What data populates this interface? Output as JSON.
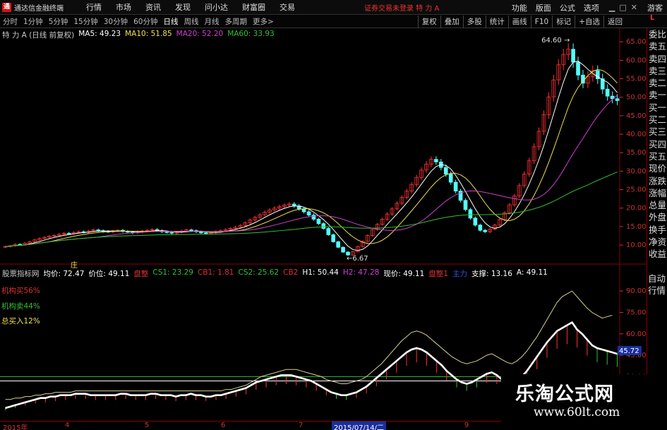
{
  "app": {
    "name": "通达信金融终端",
    "logo_char": "通",
    "login_notice": "证券交易未登录  特 力 A",
    "menu": [
      "行情",
      "市场",
      "资讯",
      "发现",
      "问小达",
      "财富圈",
      "交易"
    ],
    "right_menu": [
      "功能",
      "版面",
      "公式",
      "选项"
    ],
    "guest": "游客"
  },
  "periods": [
    "分时",
    "1分钟",
    "5分钟",
    "15分钟",
    "30分钟",
    "60分钟",
    "日线",
    "周线",
    "月线",
    "多周期",
    "更多>"
  ],
  "active_period": "日线",
  "toolbar": [
    "复权",
    "叠加",
    "多股",
    "统计",
    "画线",
    "F10",
    "标记",
    "+自选",
    "返回"
  ],
  "right_panel": {
    "top": [
      "委比",
      "卖五",
      "卖四",
      "卖三",
      "卖二",
      "卖一",
      "买一",
      "买二",
      "买三",
      "买四",
      "买五",
      "现价",
      "涨跌",
      "涨幅",
      "总量",
      "外盘",
      "换手",
      "净资",
      "收益"
    ],
    "bottom": [
      "自动",
      "行情"
    ],
    "indicator_l": "L"
  },
  "ma_legend": {
    "title": "特 力 A (日线 前复权)",
    "items": [
      {
        "label": "MA5: 49.23",
        "color": "#ffffff"
      },
      {
        "label": "MA10: 51.85",
        "color": "#f0e050"
      },
      {
        "label": "MA20: 52.20",
        "color": "#d040d0"
      },
      {
        "label": "MA60: 33.93",
        "color": "#30c030"
      }
    ]
  },
  "indicator_legend": {
    "title": "股票指标网",
    "items": [
      {
        "label": "均价: 72.47",
        "color": "#ffffff"
      },
      {
        "label": "价位: 49.11",
        "color": "#ffffff"
      },
      {
        "label": "盘整",
        "color": "#e03030"
      },
      {
        "label": "CS1: 23.29",
        "color": "#30c030"
      },
      {
        "label": "CB1: 1.81",
        "color": "#e03030"
      },
      {
        "label": "CS2: 25.62",
        "color": "#30c030"
      },
      {
        "label": "CB2",
        "color": "#e03030"
      },
      {
        "label": "H1: 50.44",
        "color": "#ffffff"
      },
      {
        "label": "H2: 47.28",
        "color": "#d040d0"
      },
      {
        "label": "现价: 49.11",
        "color": "#ffffff"
      },
      {
        "label": "盘整1",
        "color": "#e03030"
      },
      {
        "label": "主力",
        "color": "#3050e0"
      },
      {
        "label": "支撑: 13.16",
        "color": "#ffffff"
      },
      {
        "label": "A: 49.11",
        "color": "#ffffff"
      }
    ],
    "side": [
      {
        "label": "机构买56%",
        "color": "#e03030"
      },
      {
        "label": "机构卖44%",
        "color": "#30c030"
      },
      {
        "label": "总买入12%",
        "color": "#f0e050"
      }
    ],
    "top_marker": "庄",
    "current_value": "45.72"
  },
  "watermark": {
    "cn": "乐淘公式网",
    "url": "www.60lt.com"
  },
  "chart_data": [
    {
      "type": "candlestick",
      "title": "特 力 A (日线 前复权)",
      "ylim": [
        6,
        66
      ],
      "yticks": [
        10,
        15,
        20,
        25,
        30,
        35,
        40,
        45,
        50,
        55,
        60,
        65
      ],
      "annotations": [
        {
          "text": "64.60",
          "note": "high"
        },
        {
          "text": "6.67",
          "note": "low"
        }
      ],
      "close": [
        9.6,
        9.8,
        10.2,
        10.1,
        10.5,
        10.9,
        11.4,
        11.8,
        12.1,
        12.4,
        12.6,
        12.9,
        13.2,
        13.1,
        13.4,
        13.6,
        13.5,
        13.8,
        14.1,
        13.9,
        13.7,
        13.6,
        13.8,
        14.0,
        13.7,
        13.5,
        13.3,
        13.6,
        13.8,
        14.0,
        14.2,
        13.9,
        13.6,
        13.4,
        13.2,
        13.5,
        13.8,
        14.1,
        13.9,
        13.6,
        13.3,
        13.1,
        13.4,
        13.7,
        13.9,
        14.2,
        14.5,
        14.8,
        15.3,
        16.0,
        16.8,
        17.5,
        18.2,
        18.9,
        19.5,
        20.0,
        20.4,
        20.8,
        21.1,
        20.6,
        19.8,
        19.0,
        18.1,
        17.0,
        15.8,
        14.5,
        12.8,
        10.9,
        9.4,
        8.1,
        7.3,
        8.2,
        9.6,
        11.0,
        12.6,
        14.2,
        15.6,
        17.0,
        18.4,
        19.8,
        21.3,
        22.9,
        24.6,
        26.4,
        28.3,
        30.3,
        31.9,
        33.2,
        32.5,
        31.0,
        29.2,
        27.0,
        24.6,
        22.1,
        19.6,
        17.3,
        15.4,
        14.0,
        13.6,
        14.3,
        15.4,
        16.9,
        18.7,
        20.9,
        23.3,
        26.1,
        29.2,
        32.8,
        36.6,
        40.8,
        45.3,
        50.1,
        54.7,
        58.8,
        61.6,
        63.0,
        59.5,
        56.0,
        53.8,
        55.6,
        57.2,
        55.0,
        52.2,
        50.3,
        49.6,
        49.1
      ],
      "ma_periods": [
        5,
        10,
        20,
        60
      ]
    },
    {
      "type": "line",
      "title": "股票指标网",
      "ylim": [
        0,
        100
      ],
      "yticks": [
        15,
        30,
        45,
        60,
        75,
        90
      ],
      "series_name_labels": [
        "均价",
        "价位",
        "CS1",
        "CS2",
        "H1",
        "H2"
      ],
      "values_white": [
        8,
        9,
        10,
        11,
        12,
        13,
        14,
        15,
        15,
        16,
        16,
        17,
        17,
        17,
        18,
        18,
        18,
        17,
        17,
        17,
        17,
        17,
        17,
        18,
        18,
        17,
        17,
        17,
        17,
        18,
        18,
        17,
        17,
        17,
        16,
        17,
        17,
        18,
        17,
        17,
        16,
        16,
        17,
        17,
        18,
        19,
        20,
        21,
        22,
        24,
        26,
        27,
        28,
        29,
        30,
        31,
        31,
        31,
        30,
        29,
        28,
        27,
        25,
        23,
        21,
        19,
        18,
        17,
        17,
        18,
        19,
        21,
        23,
        26,
        29,
        32,
        35,
        38,
        41,
        44,
        47,
        49,
        50,
        49,
        47,
        44,
        41,
        38,
        34,
        31,
        28,
        26,
        25,
        26,
        28,
        30,
        32,
        33,
        31,
        28,
        26,
        25,
        27,
        30,
        34,
        39,
        44,
        49,
        54,
        58,
        62,
        64,
        66,
        68,
        63,
        60,
        56,
        52,
        50,
        49,
        48,
        47,
        46
      ],
      "values_yellow": [
        14,
        14,
        15,
        15,
        16,
        16,
        17,
        17,
        18,
        18,
        19,
        19,
        19,
        19,
        20,
        20,
        20,
        20,
        20,
        20,
        20,
        20,
        20,
        20,
        20,
        20,
        20,
        20,
        20,
        20,
        20,
        20,
        20,
        20,
        20,
        20,
        20,
        20,
        20,
        20,
        20,
        20,
        20,
        20,
        21,
        21,
        22,
        23,
        24,
        26,
        28,
        30,
        31,
        32,
        33,
        34,
        35,
        35,
        35,
        34,
        33,
        32,
        31,
        30,
        28,
        27,
        26,
        25,
        25,
        26,
        27,
        28,
        30,
        33,
        36,
        39,
        43,
        47,
        51,
        55,
        58,
        61,
        62,
        61,
        59,
        56,
        53,
        50,
        47,
        44,
        42,
        40,
        39,
        40,
        41,
        43,
        45,
        46,
        44,
        42,
        40,
        39,
        41,
        44,
        48,
        53,
        58,
        64,
        70,
        76,
        82,
        86,
        88,
        90,
        86,
        82,
        78,
        75,
        73,
        71,
        72,
        73
      ]
    }
  ]
}
